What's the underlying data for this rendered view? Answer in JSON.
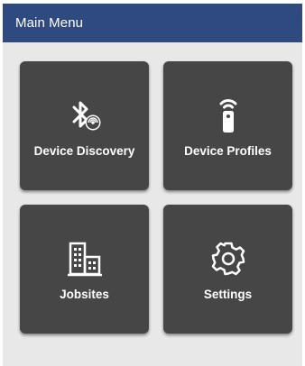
{
  "header": {
    "title": "Main Menu"
  },
  "tiles": [
    {
      "label": "Device Discovery",
      "icon": "bluetooth-search-icon"
    },
    {
      "label": "Device Profiles",
      "icon": "remote-wireless-icon"
    },
    {
      "label": "Jobsites",
      "icon": "buildings-icon"
    },
    {
      "label": "Settings",
      "icon": "gear-icon"
    }
  ],
  "colors": {
    "header_bg": "#2f4a7e",
    "tile_bg": "#464646",
    "menu_bg": "#e8e8e8",
    "text": "#ffffff"
  }
}
